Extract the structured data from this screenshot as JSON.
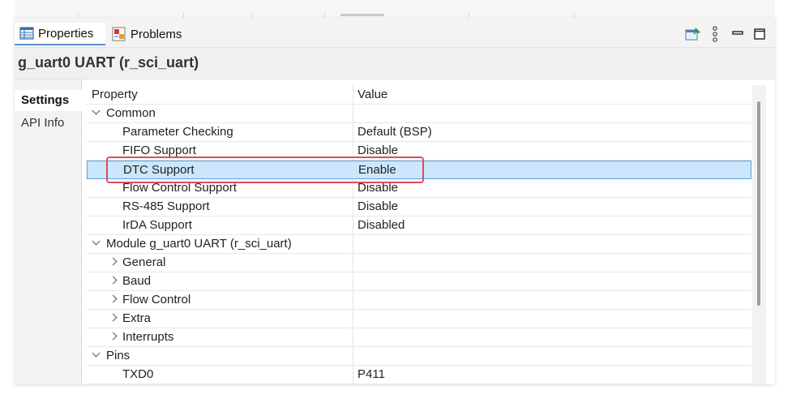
{
  "tabs": [
    {
      "label": "Properties",
      "icon": "properties-table-icon",
      "active": true
    },
    {
      "label": "Problems",
      "icon": "problems-icon",
      "active": false
    }
  ],
  "toolbar": {
    "icons": [
      "pin-view-icon",
      "view-menu-icon",
      "minimize-icon",
      "maximize-icon"
    ]
  },
  "title": "g_uart0 UART (r_sci_uart)",
  "side_tabs": [
    {
      "label": "Settings",
      "active": true
    },
    {
      "label": "API Info",
      "active": false
    }
  ],
  "grid": {
    "headers": {
      "property": "Property",
      "value": "Value"
    },
    "rows": [
      {
        "label": "Common",
        "value": "",
        "expander": "down"
      },
      {
        "label": "Parameter Checking",
        "value": "Default (BSP)",
        "expander": ""
      },
      {
        "label": "FIFO Support",
        "value": "Disable",
        "expander": ""
      },
      {
        "label": "DTC Support",
        "value": "Enable",
        "expander": "",
        "selected": true
      },
      {
        "label": "Flow Control Support",
        "value": "Disable",
        "expander": ""
      },
      {
        "label": "RS-485 Support",
        "value": "Disable",
        "expander": ""
      },
      {
        "label": "IrDA Support",
        "value": "Disabled",
        "expander": ""
      },
      {
        "label": "Module g_uart0 UART (r_sci_uart)",
        "value": "",
        "expander": "down"
      },
      {
        "label": "General",
        "value": "",
        "expander": "right"
      },
      {
        "label": "Baud",
        "value": "",
        "expander": "right"
      },
      {
        "label": "Flow Control",
        "value": "",
        "expander": "right"
      },
      {
        "label": "Extra",
        "value": "",
        "expander": "right"
      },
      {
        "label": "Interrupts",
        "value": "",
        "expander": "right"
      },
      {
        "label": "Pins",
        "value": "",
        "expander": "down"
      },
      {
        "label": "TXD0",
        "value": "P411",
        "expander": ""
      }
    ]
  },
  "colors": {
    "selection": "#cce6fb",
    "selection_border": "#5aa0dd",
    "highlight_box": "#e34a5c"
  }
}
